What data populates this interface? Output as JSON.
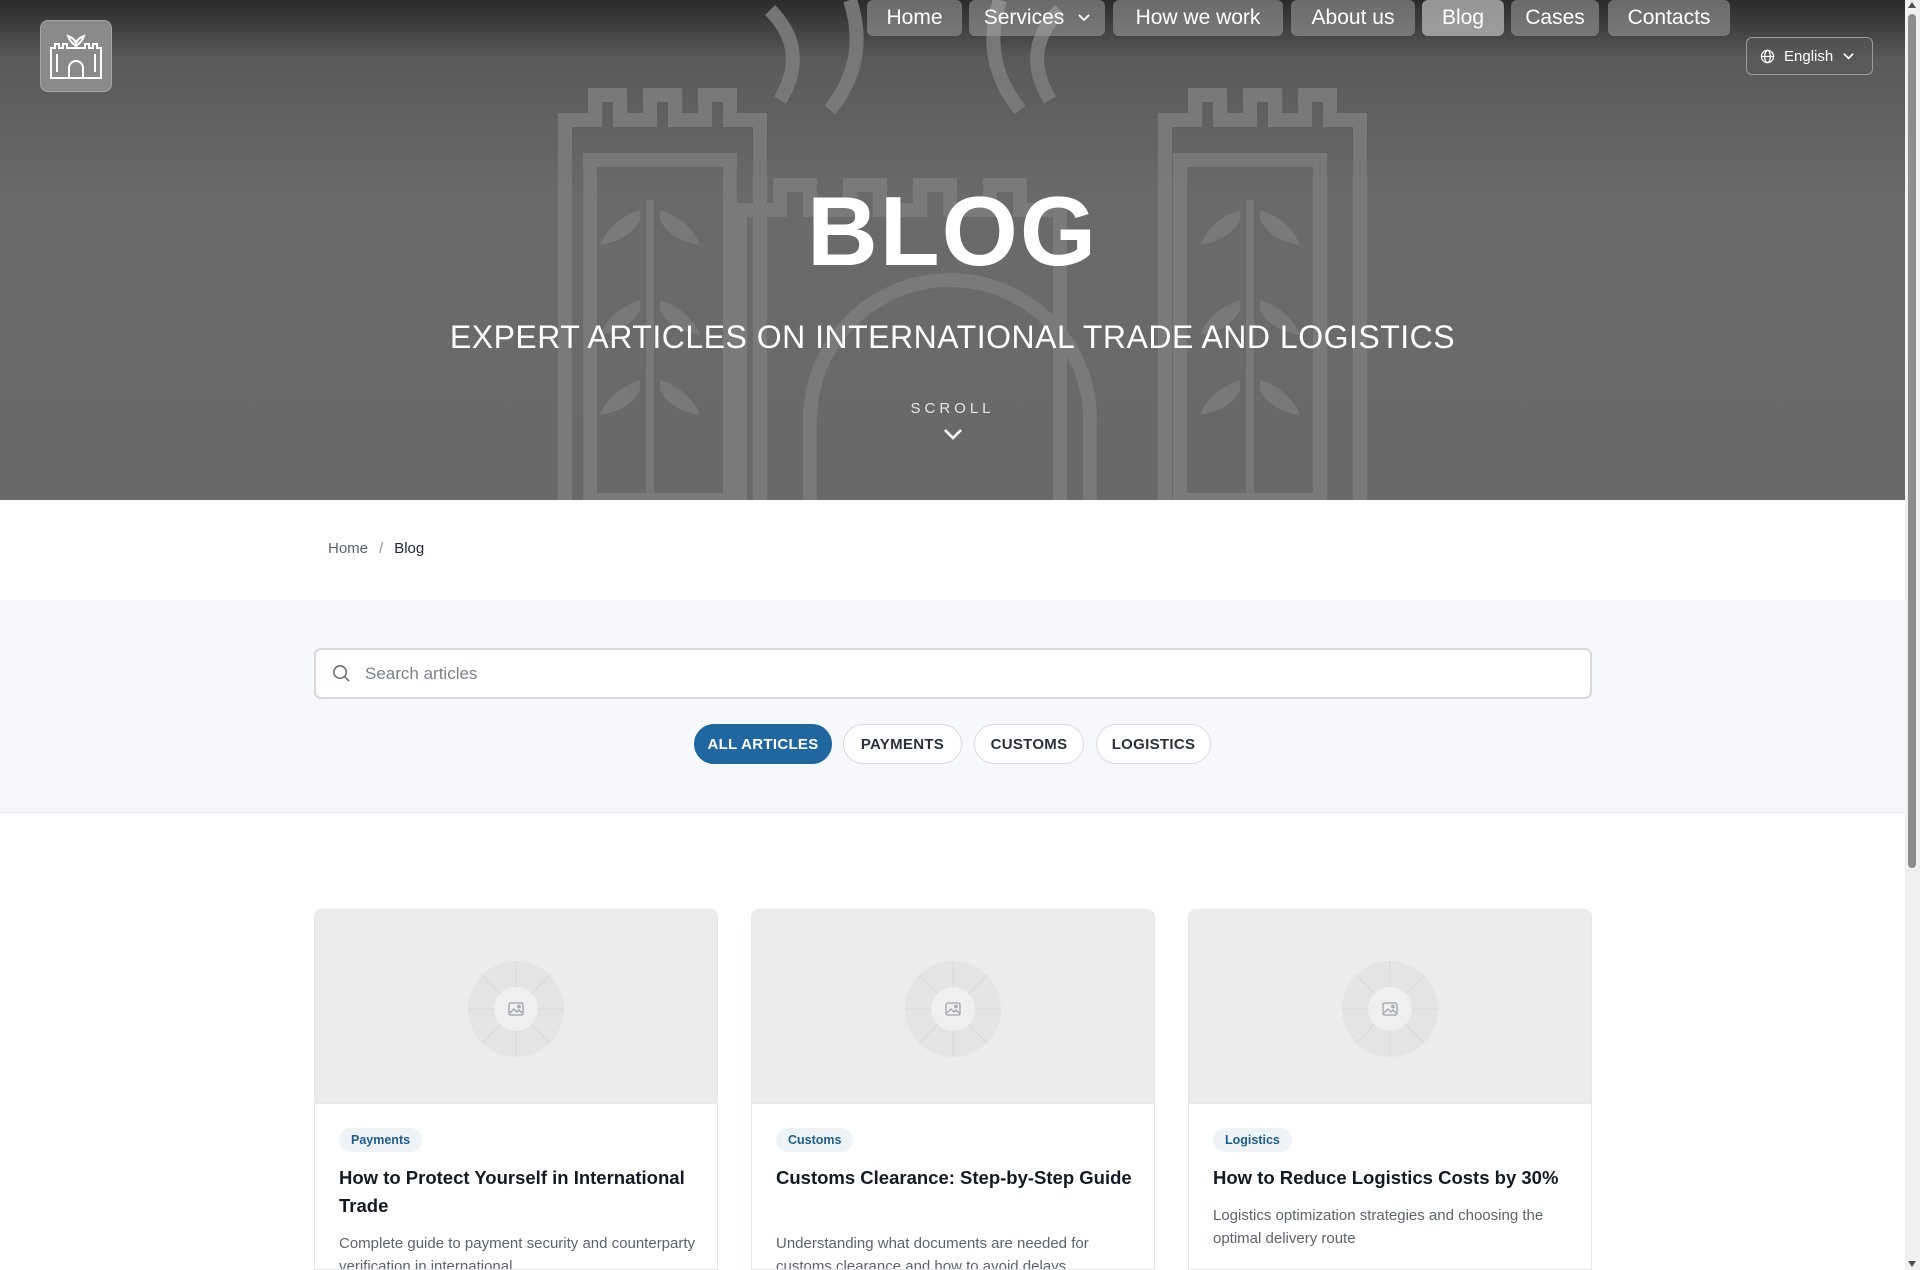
{
  "nav": {
    "items": [
      {
        "label": "Home",
        "has_dropdown": false,
        "active": false
      },
      {
        "label": "Services",
        "has_dropdown": true,
        "active": false
      },
      {
        "label": "How we work",
        "has_dropdown": false,
        "active": false
      },
      {
        "label": "About us",
        "has_dropdown": false,
        "active": false
      },
      {
        "label": "Blog",
        "has_dropdown": false,
        "active": true
      },
      {
        "label": "Cases",
        "has_dropdown": false,
        "active": false
      },
      {
        "label": "Contacts",
        "has_dropdown": false,
        "active": false
      }
    ],
    "language": "English",
    "language_icon": "globe-icon"
  },
  "hero": {
    "title": "BLOG",
    "subtitle": "EXPERT ARTICLES ON INTERNATIONAL TRADE AND LOGISTICS",
    "scroll_label": "SCROLL"
  },
  "breadcrumb": {
    "home": "Home",
    "separator": "/",
    "current": "Blog"
  },
  "search": {
    "placeholder": "Search articles",
    "value": ""
  },
  "filters": {
    "items": [
      "ALL ARTICLES",
      "PAYMENTS",
      "CUSTOMS",
      "LOGISTICS"
    ],
    "active": "ALL ARTICLES"
  },
  "articles": [
    {
      "tag": "Payments",
      "title": "How to Protect Yourself in International Trade",
      "description": "Complete guide to payment security and counterparty verification in international"
    },
    {
      "tag": "Customs",
      "title": "Customs Clearance: Step-by-Step Guide",
      "description": "Understanding what documents are needed for customs clearance and how to avoid delays"
    },
    {
      "tag": "Logistics",
      "title": "How to Reduce Logistics Costs by 30%",
      "description": "Logistics optimization strategies and choosing the optimal delivery route"
    }
  ],
  "colors": {
    "accent": "#1f679e",
    "tag_text": "#1f5d8e",
    "tag_bg": "#eef3f8",
    "hero_bg": "#696969"
  }
}
